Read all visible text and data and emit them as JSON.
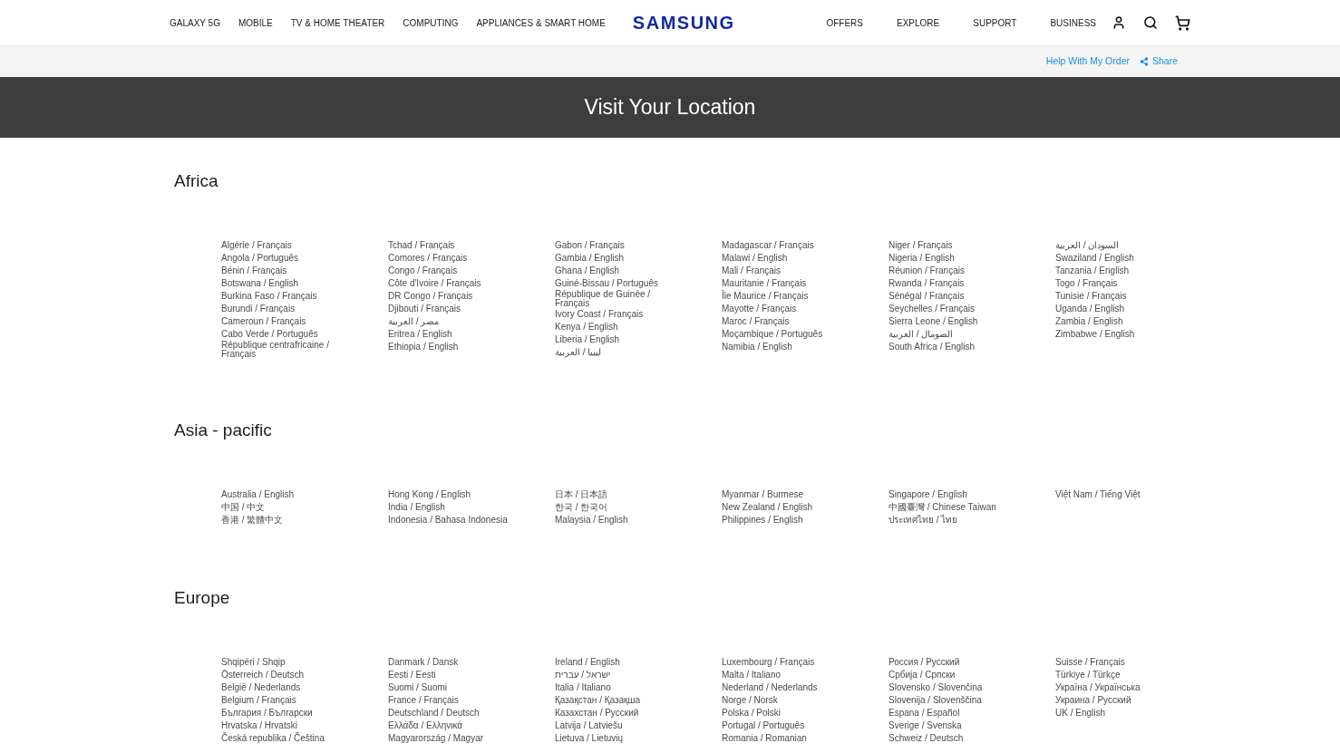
{
  "nav": {
    "left": [
      "GALAXY 5G",
      "MOBILE",
      "TV & HOME THEATER",
      "COMPUTING",
      "APPLIANCES & SMART HOME"
    ],
    "logo": "SAMSUNG",
    "right": [
      "OFFERS",
      "EXPLORE",
      "SUPPORT",
      "BUSINESS"
    ]
  },
  "utility_bar": {
    "links": [
      {
        "kind": "link",
        "label": "Help With My Order"
      },
      {
        "kind": "share",
        "label": "Share"
      }
    ]
  },
  "banner": {
    "title": "Visit Your Location"
  },
  "regions": [
    {
      "name": "Africa",
      "columns": [
        [
          "Algérie / Français",
          "Angola / Português",
          "Bénin / Français",
          "Botswana / English",
          "Burkina Faso / Français",
          "Burundi / Français",
          "Cameroun / Français",
          "Cabo Verde / Português",
          "République centrafricaine / Français"
        ],
        [
          "Tchad / Français",
          "Comores / Français",
          "Congo / Français",
          "Côte d'Ivoire / Français",
          "DR Congo / Français",
          "Djibouti / Français",
          "مصر / العربية",
          "Eritrea / English",
          "Ethiopia / English"
        ],
        [
          "Gabon / Français",
          "Gambia / English",
          "Ghana / English",
          "Guiné-Bissau / Português",
          "République de Guinée / Français",
          "Ivory Coast / Français",
          "Kenya / English",
          "Liberia / English",
          "ليبيا / العربية"
        ],
        [
          "Madagascar / Français",
          "Malawi / English",
          "Mali / Français",
          "Mauritanie / Français",
          "Île Maurice / Français",
          "Mayotte / Français",
          "Maroc / Français",
          "Moçambique / Português",
          "Namibia / English"
        ],
        [
          "Niger / Français",
          "Nigeria / English",
          "Réunion / Français",
          "Rwanda / Français",
          "Sénégal / Français",
          "Seychelles / Français",
          "Sierra Leone / English",
          "الصومال / العربية",
          "South Africa / English"
        ],
        [
          "السودان / العربية",
          "Swaziland / English",
          "Tanzania / English",
          "Togo / Français",
          "Tunisie / Français",
          "Uganda / English",
          "Zambia / English",
          "Zimbabwe / English"
        ]
      ]
    },
    {
      "name": "Asia - pacific",
      "columns": [
        [
          "Australia / English",
          "中国 / 中文",
          "香港 / 繁體中文"
        ],
        [
          "Hong Kong / English",
          "India / English",
          "Indonesia / Bahasa Indonesia"
        ],
        [
          "日本 / 日本語",
          "한국 / 한국어",
          "Malaysia / English"
        ],
        [
          "Myanmar / Burmese",
          "New Zealand / English",
          "Philippines / English"
        ],
        [
          "Singapore / English",
          "中國臺灣 / Chinese Taiwan",
          "ประเทศไทย / ไทย"
        ],
        [
          "Việt Nam / Tiếng Việt"
        ]
      ]
    },
    {
      "name": "Europe",
      "columns": [
        [
          "Shqipëri / Shqip",
          "Österreich / Deutsch",
          "België / Nederlands",
          "Belgium / Français",
          "България / Български",
          "Hrvatska / Hrvatski",
          "Česká republika / Čeština"
        ],
        [
          "Danmark / Dansk",
          "Eesti / Eesti",
          "Suomi / Suomi",
          "France / Français",
          "Deutschland / Deutsch",
          "Ελλάδα / Ελληνικά",
          "Magyarország / Magyar"
        ],
        [
          "Ireland / English",
          "ישראל / עברית",
          "Italia / Italiano",
          "Қазақстан / Қазақша",
          "Казахстан / Русский",
          "Latvija / Latviešu",
          "Lietuva / Lietuvių"
        ],
        [
          "Luxembourg / Français",
          "Malta / Italiano",
          "Nederland / Nederlands",
          "Norge / Norsk",
          "Polska / Polski",
          "Portugal / Português",
          "Romania / Romanian"
        ],
        [
          "Россия / Русский",
          "Србија / Српски",
          "Slovensko / Slovenčina",
          "Slovenija / Slovenščina",
          "Espana / Español",
          "Sverige / Svenska",
          "Schweiz / Deutsch"
        ],
        [
          "Suisse / Français",
          "Türkiye / Türkçe",
          "Україна / Українська",
          "Украина / Русский",
          "UK / English"
        ]
      ]
    }
  ]
}
